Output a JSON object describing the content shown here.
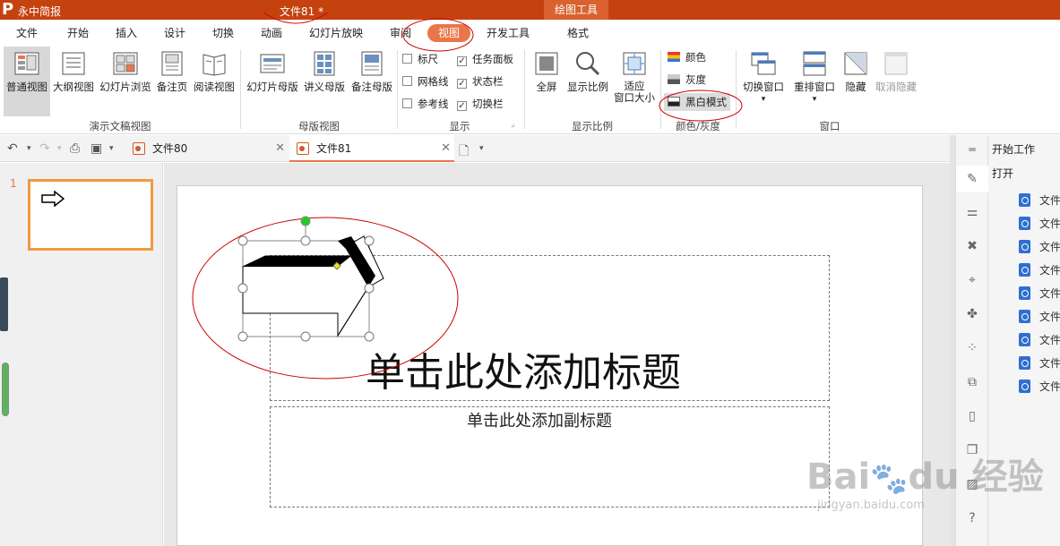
{
  "app": {
    "name": "永中简报",
    "doc_title": "文件81 *",
    "context_tab": "绘图工具"
  },
  "menu": [
    "文件",
    "开始",
    "插入",
    "设计",
    "切换",
    "动画",
    "幻灯片放映",
    "审阅",
    "视图",
    "开发工具",
    "格式"
  ],
  "ribbon": {
    "presentation_views": [
      "普通视图",
      "大纲视图",
      "幻灯片浏览",
      "备注页",
      "阅读视图"
    ],
    "presentation_views_label": "演示文稿视图",
    "master_views": [
      "幻灯片母版",
      "讲义母版",
      "备注母版"
    ],
    "master_views_label": "母版视图",
    "show": {
      "ruler": "标尺",
      "task_pane": "任务面板",
      "gridlines": "网格线",
      "status_bar": "状态栏",
      "guides": "参考线",
      "switch_bar": "切换栏",
      "label": "显示"
    },
    "zoom": {
      "fullscreen": "全屏",
      "zoom_ratio": "显示比例",
      "fit_l1": "适应",
      "fit_l2": "窗口大小",
      "label": "显示比例"
    },
    "color": {
      "color": "颜色",
      "gray": "灰度",
      "bw": "黑白模式",
      "label": "颜色/灰度"
    },
    "window": {
      "switch": "切换窗口",
      "arrange": "重排窗口",
      "hide": "隐藏",
      "unhide": "取消隐藏",
      "label": "窗口"
    }
  },
  "tabs": [
    {
      "label": "文件80"
    },
    {
      "label": "文件81"
    }
  ],
  "thumbs": {
    "slide_number": "1"
  },
  "slide": {
    "title": "单击此处添加标题",
    "subtitle": "单击此处添加副标题"
  },
  "right_pane": {
    "header": "开始工作",
    "open": "打开",
    "recent": [
      "文件",
      "文件",
      "文件",
      "文件",
      "文件",
      "文件",
      "文件",
      "文件",
      "文件"
    ]
  },
  "colors": {
    "titlebar": "#c5420f",
    "accent": "#e8764a",
    "annotation": "#cc0000"
  }
}
